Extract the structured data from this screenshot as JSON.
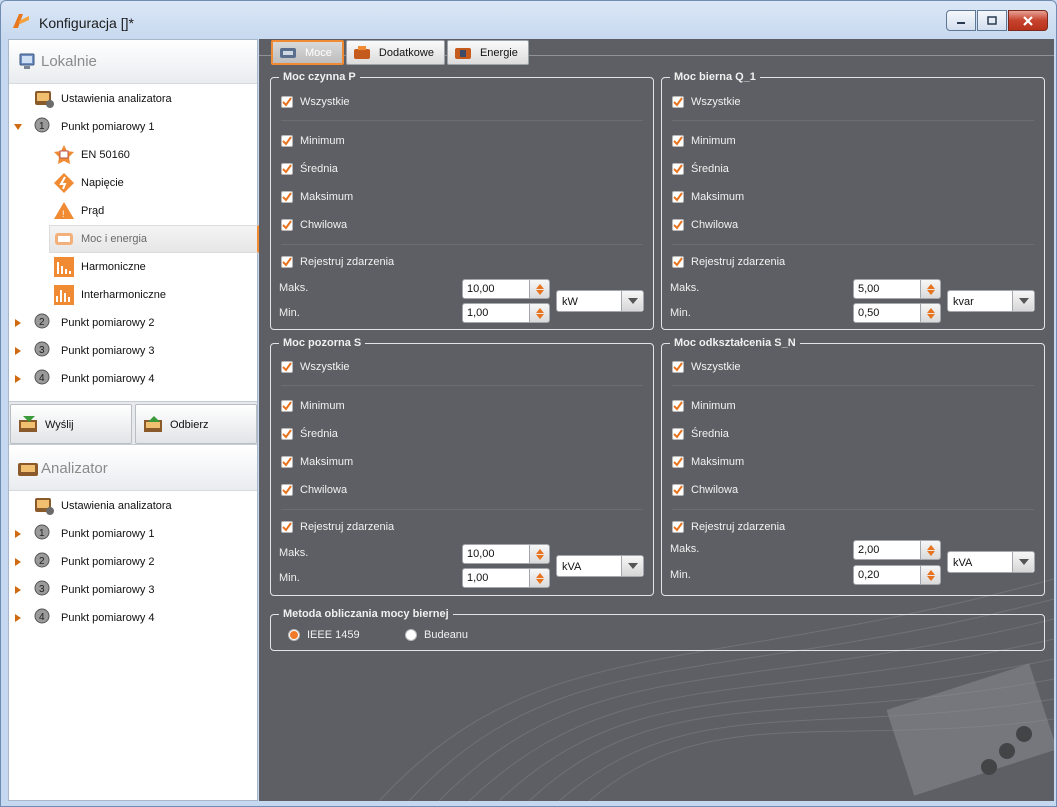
{
  "window": {
    "title": "Konfiguracja []*"
  },
  "sidebar": {
    "local_header": "Lokalnie",
    "local_items": [
      {
        "label": "Ustawienia analizatora"
      },
      {
        "label": "Punkt pomiarowy 1"
      },
      {
        "label": "EN 50160"
      },
      {
        "label": "Napięcie"
      },
      {
        "label": "Prąd"
      },
      {
        "label": "Moc i energia"
      },
      {
        "label": "Harmoniczne"
      },
      {
        "label": "Interharmoniczne"
      },
      {
        "label": "Punkt pomiarowy 2"
      },
      {
        "label": "Punkt pomiarowy 3"
      },
      {
        "label": "Punkt pomiarowy 4"
      }
    ],
    "actions": {
      "send": "Wyślij",
      "receive": "Odbierz"
    },
    "analyzer_header": "Analizator",
    "analyzer_items": [
      {
        "label": "Ustawienia analizatora"
      },
      {
        "label": "Punkt pomiarowy 1"
      },
      {
        "label": "Punkt pomiarowy 2"
      },
      {
        "label": "Punkt pomiarowy 3"
      },
      {
        "label": "Punkt pomiarowy 4"
      }
    ]
  },
  "tabs": [
    "Moce",
    "Dodatkowe",
    "Energie"
  ],
  "common": {
    "all": "Wszystkie",
    "minimum": "Minimum",
    "average": "Średnia",
    "maximum": "Maksimum",
    "instant": "Chwilowa",
    "events": "Rejestruj zdarzenia",
    "max_label": "Maks.",
    "min_label": "Min."
  },
  "groups": {
    "p": {
      "title": "Moc czynna P",
      "max": "10,00",
      "min": "1,00",
      "unit": "kW"
    },
    "q": {
      "title": "Moc bierna Q_1",
      "max": "5,00",
      "min": "0,50",
      "unit": "kvar"
    },
    "s": {
      "title": "Moc pozorna S",
      "max": "10,00",
      "min": "1,00",
      "unit": "kVA"
    },
    "sn": {
      "title": "Moc odkształcenia S_N",
      "max": "2,00",
      "min": "0,20",
      "unit": "kVA"
    }
  },
  "method": {
    "title": "Metoda obliczania mocy biernej",
    "opt1": "IEEE 1459",
    "opt2": "Budeanu",
    "selected": "IEEE 1459"
  },
  "colors": {
    "accent": "#f08a33",
    "panel": "#5d5f64"
  }
}
